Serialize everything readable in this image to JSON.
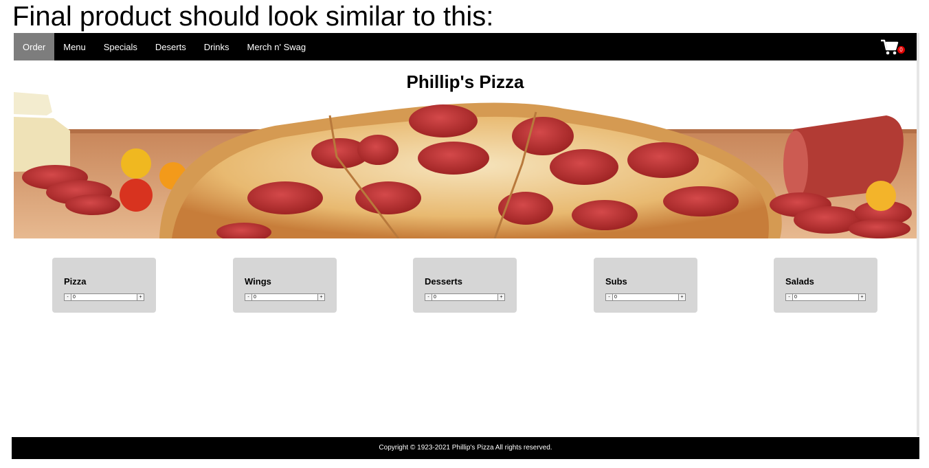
{
  "caption": "Final product should look similar to this:",
  "nav": {
    "items": [
      {
        "label": "Order",
        "active": true
      },
      {
        "label": "Menu"
      },
      {
        "label": "Specials"
      },
      {
        "label": "Deserts"
      },
      {
        "label": "Drinks"
      },
      {
        "label": "Merch n' Swag"
      }
    ],
    "cart": {
      "icon": "shopping-cart-icon",
      "count": "0"
    }
  },
  "site": {
    "title": "Phillip's Pizza"
  },
  "hero": {
    "image": "pepperoni-pizza-banner"
  },
  "categories": [
    {
      "title": "Pizza",
      "quantity": "0"
    },
    {
      "title": "Wings",
      "quantity": "0"
    },
    {
      "title": "Desserts",
      "quantity": "0"
    },
    {
      "title": "Subs",
      "quantity": "0"
    },
    {
      "title": "Salads",
      "quantity": "0"
    }
  ],
  "stepper": {
    "minus": "-",
    "plus": "+"
  },
  "footer": {
    "text": "Copyright © 1923-2021 Phillip's Pizza All rights reserved."
  },
  "colors": {
    "nav_bg": "#000000",
    "nav_active": "#7d7d7d",
    "card_bg": "#d6d6d6",
    "badge": "#e00000"
  }
}
